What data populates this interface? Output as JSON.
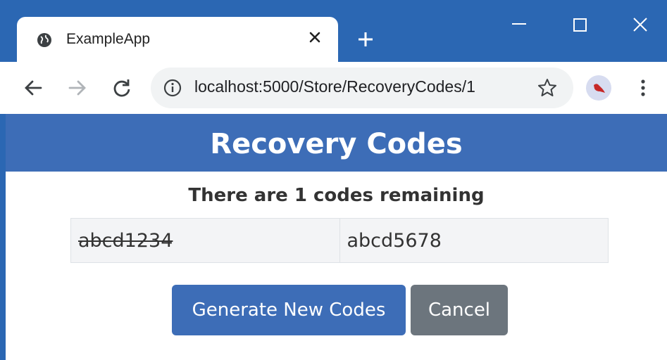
{
  "browser": {
    "tab_title": "ExampleApp",
    "url": "localhost:5000/Store/RecoveryCodes/1",
    "icons": {
      "tab": "globe-icon",
      "close_tab": "close-icon",
      "new_tab": "plus-icon",
      "back": "arrow-left-icon",
      "forward": "arrow-right-icon",
      "reload": "reload-icon",
      "info": "info-icon",
      "bookmark": "star-icon",
      "menu": "more-vertical-icon"
    }
  },
  "page": {
    "title": "Recovery Codes",
    "subtitle": "There are 1 codes remaining",
    "codes": [
      {
        "code": "abcd1234",
        "used": true
      },
      {
        "code": "abcd5678",
        "used": false
      }
    ],
    "buttons": {
      "generate": "Generate New Codes",
      "cancel": "Cancel"
    }
  },
  "colors": {
    "titlebar": "#2b67b3",
    "header": "#3d6db7",
    "primary_button": "#3d6db7",
    "secondary_button": "#6c757d",
    "table_bg": "#f3f4f6"
  }
}
